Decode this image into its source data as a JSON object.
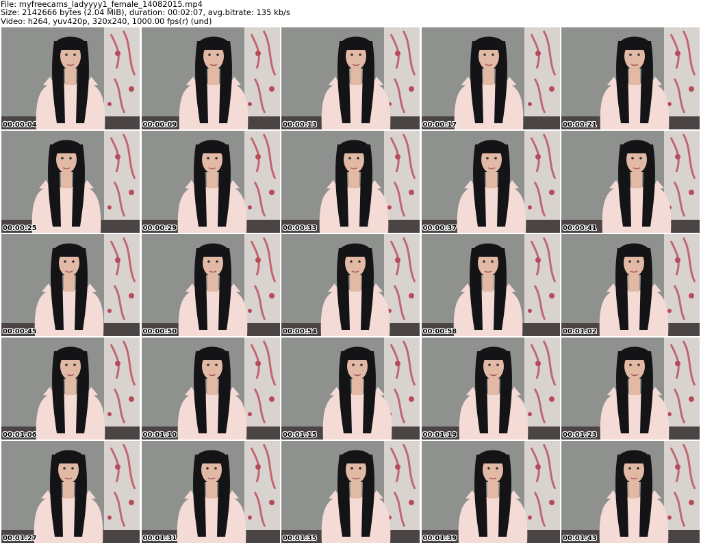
{
  "header": {
    "file_line": "File: myfreecams_ladyyyy1_female_14082015.mp4",
    "size_line": "Size: 2142666 bytes (2.04 MiB), duration: 00:02:07, avg.bitrate: 135 kb/s",
    "video_line": "Video: h264, yuv420p, 320x240, 1000.00 fps(r) (und)"
  },
  "colors": {
    "wall": "#8f918f",
    "curtain": "#d9d3cf",
    "curtain_accent": "#b94a5a",
    "hair": "#141417",
    "skin": "#e2b9a5",
    "top": "#f4dbd6"
  },
  "thumbnails": [
    {
      "timestamp": "00:00:04"
    },
    {
      "timestamp": "00:00:09"
    },
    {
      "timestamp": "00:00:13"
    },
    {
      "timestamp": "00:00:17"
    },
    {
      "timestamp": "00:00:21"
    },
    {
      "timestamp": "00:00:25"
    },
    {
      "timestamp": "00:00:29"
    },
    {
      "timestamp": "00:00:33"
    },
    {
      "timestamp": "00:00:37"
    },
    {
      "timestamp": "00:00:41"
    },
    {
      "timestamp": "00:00:45"
    },
    {
      "timestamp": "00:00:50"
    },
    {
      "timestamp": "00:00:54"
    },
    {
      "timestamp": "00:00:58"
    },
    {
      "timestamp": "00:01:02"
    },
    {
      "timestamp": "00:01:06"
    },
    {
      "timestamp": "00:01:10"
    },
    {
      "timestamp": "00:01:15"
    },
    {
      "timestamp": "00:01:19"
    },
    {
      "timestamp": "00:01:23"
    },
    {
      "timestamp": "00:01:27"
    },
    {
      "timestamp": "00:01:31"
    },
    {
      "timestamp": "00:01:35"
    },
    {
      "timestamp": "00:01:39"
    },
    {
      "timestamp": "00:01:43"
    }
  ]
}
